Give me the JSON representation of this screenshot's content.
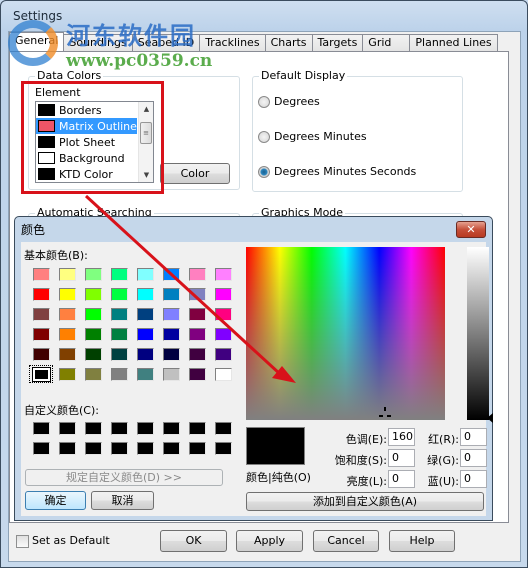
{
  "window": {
    "title": "Settings",
    "tabs": [
      {
        "label": "General",
        "active": true
      },
      {
        "label": "Soundings",
        "active": false
      },
      {
        "label": "Seabed ID",
        "active": false
      },
      {
        "label": "Tracklines",
        "active": false
      },
      {
        "label": "Charts",
        "active": false
      },
      {
        "label": "Targets",
        "active": false
      },
      {
        "label": "Grid",
        "active": false
      },
      {
        "label": "Planned Lines",
        "active": false
      }
    ]
  },
  "watermark": {
    "line1": "河东软件园",
    "line2": "www.pc0359.cn"
  },
  "data_colors": {
    "group_label": "Data Colors",
    "element_label": "Element",
    "items": [
      {
        "label": "Borders",
        "color": "#000000",
        "selected": false
      },
      {
        "label": "Matrix Outline",
        "color": "#ee5566",
        "selected": true
      },
      {
        "label": "Plot Sheet",
        "color": "#000000",
        "selected": false
      },
      {
        "label": "Background",
        "color": "#ffffff",
        "selected": false
      },
      {
        "label": "KTD Color",
        "color": "#000000",
        "selected": false
      }
    ],
    "color_button": "Color"
  },
  "default_display": {
    "group_label": "Default Display",
    "options": [
      {
        "label": "Degrees",
        "checked": false
      },
      {
        "label": "Degrees Minutes",
        "checked": false
      },
      {
        "label": "Degrees Minutes Seconds",
        "checked": true
      }
    ]
  },
  "automatic_searching": {
    "group_label": "Automatic Searching"
  },
  "graphics_mode": {
    "group_label": "Graphics Mode"
  },
  "color_dialog": {
    "title": "颜色",
    "close_icon": "close-icon",
    "basic_colors_label": "基本颜色(B):",
    "basic_colors": [
      "#ff8080",
      "#ffff80",
      "#80ff80",
      "#00ff80",
      "#80ffff",
      "#0080ff",
      "#ff80c0",
      "#ff80ff",
      "#ff0000",
      "#ffff00",
      "#80ff00",
      "#00ff40",
      "#00ffff",
      "#0080c0",
      "#8080c0",
      "#ff00ff",
      "#804040",
      "#ff8040",
      "#00ff00",
      "#008080",
      "#004080",
      "#8080ff",
      "#800040",
      "#ff0080",
      "#800000",
      "#ff8000",
      "#008000",
      "#008040",
      "#0000ff",
      "#0000a0",
      "#800080",
      "#8000ff",
      "#400000",
      "#804000",
      "#004000",
      "#004040",
      "#000080",
      "#000040",
      "#400040",
      "#400080",
      "#000000",
      "#808000",
      "#808040",
      "#808080",
      "#408080",
      "#c0c0c0",
      "#400040",
      "#ffffff"
    ],
    "selected_basic_index": 40,
    "custom_colors_label": "自定义颜色(C):",
    "custom_colors": [
      "#000000",
      "#000000",
      "#000000",
      "#000000",
      "#000000",
      "#000000",
      "#000000",
      "#000000",
      "#000000",
      "#000000",
      "#000000",
      "#000000",
      "#000000",
      "#000000",
      "#000000",
      "#000000"
    ],
    "define_custom_button": "规定自定义颜色(D) >>",
    "ok_button": "确定",
    "cancel_button": "取消",
    "preview_label": "颜色|纯色(O)",
    "preview_color": "#000000",
    "fields": {
      "hue": {
        "label": "色调(E):",
        "value": "160"
      },
      "sat": {
        "label": "饱和度(S):",
        "value": "0"
      },
      "lum": {
        "label": "亮度(L):",
        "value": "0"
      },
      "red": {
        "label": "红(R):",
        "value": "0"
      },
      "green": {
        "label": "绿(G):",
        "value": "0"
      },
      "blue": {
        "label": "蓝(U):",
        "value": "0"
      }
    },
    "add_custom_button": "添加到自定义颜色(A)"
  },
  "footer": {
    "set_default_label": "Set as Default",
    "set_default_checked": false,
    "ok": "OK",
    "apply": "Apply",
    "cancel": "Cancel",
    "help": "Help"
  },
  "annotation": {
    "highlight_color": "#d8121a",
    "arrow_color": "#d8121a"
  }
}
